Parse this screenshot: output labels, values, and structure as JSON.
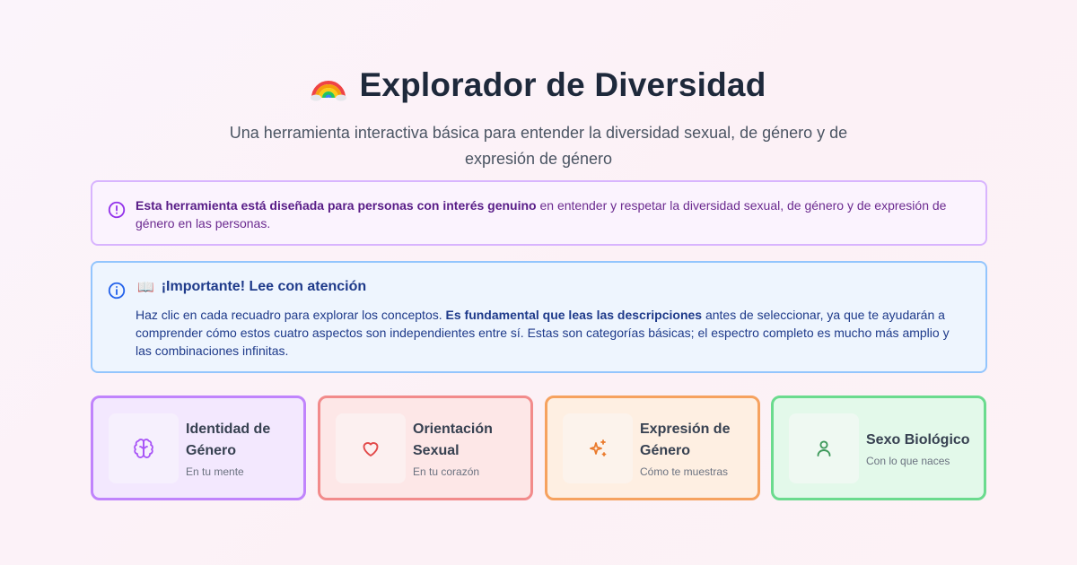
{
  "header": {
    "title": "Explorador de Diversidad",
    "title_icon": "rainbow-icon",
    "subtitle": "Una herramienta interactiva básica para entender la diversidad sexual, de género y de expresión de género"
  },
  "notice_interest": {
    "icon": "alert-circle-icon",
    "bold_text": "Esta herramienta está diseñada para personas con interés genuino",
    "text": " en entender y respetar la diversidad sexual, de género y de expresión de género en las personas."
  },
  "notice_important": {
    "icon": "info-icon",
    "heading_emoji": "📖",
    "heading": "¡Importante! Lee con atención",
    "text_before": "Haz clic en cada recuadro para explorar los conceptos. ",
    "bold_text": "Es fundamental que leas las descripciones",
    "text_after": " antes de seleccionar, ya que te ayudarán a comprender cómo estos cuatro aspectos son independientes entre sí. Estas son categorías básicas; el espectro completo es mucho más amplio y las combinaciones infinitas."
  },
  "cards": [
    {
      "title": "Identidad de Género",
      "subtitle": "En tu mente",
      "icon": "brain-icon",
      "color": "#a855f7"
    },
    {
      "title": "Orientación Sexual",
      "subtitle": "En tu corazón",
      "icon": "heart-icon",
      "color": "#e24a4a"
    },
    {
      "title": "Expresión de Género",
      "subtitle": "Cómo te muestras",
      "icon": "sparkles-icon",
      "color": "#ea7a2c"
    },
    {
      "title": "Sexo Biológico",
      "subtitle": "Con lo que naces",
      "icon": "user-icon",
      "color": "#3f9a5c"
    }
  ],
  "colors": {
    "purple_border": "#d8b4fe",
    "blue_border": "#93c5fd",
    "heading_dark": "#1e293b"
  }
}
